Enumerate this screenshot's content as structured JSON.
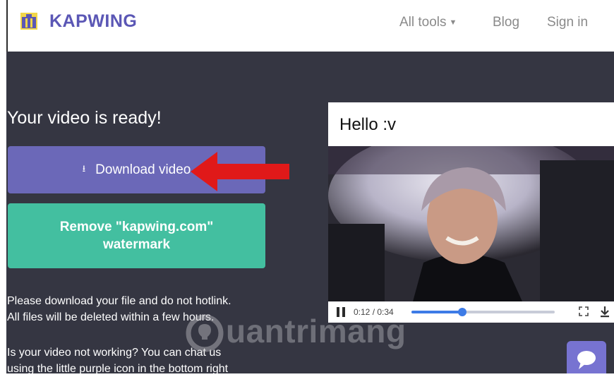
{
  "header": {
    "brand": "KAPWING",
    "nav": {
      "all_tools": "All tools",
      "blog": "Blog",
      "sign_in": "Sign in"
    }
  },
  "main": {
    "title": "Your video is ready!",
    "download_button": "Download video",
    "watermark_button_line1": "Remove \"kapwing.com\"",
    "watermark_button_line2": "watermark",
    "info1_line1": "Please download your file and do not hotlink.",
    "info1_line2": "All files will be deleted within a few hours.",
    "info2_line1": "Is your video not working? You can chat us",
    "info2_line2": "using the little purple icon in the bottom right"
  },
  "video": {
    "title": "Hello :v",
    "time": "0:12 / 0:34",
    "progress": 0.353
  },
  "watermark_text": "uantrimang",
  "colors": {
    "brand": "#5b57b5",
    "download": "#6b68b8",
    "remove": "#43bfa0",
    "dark": "#353642",
    "arrow": "#e01919"
  }
}
